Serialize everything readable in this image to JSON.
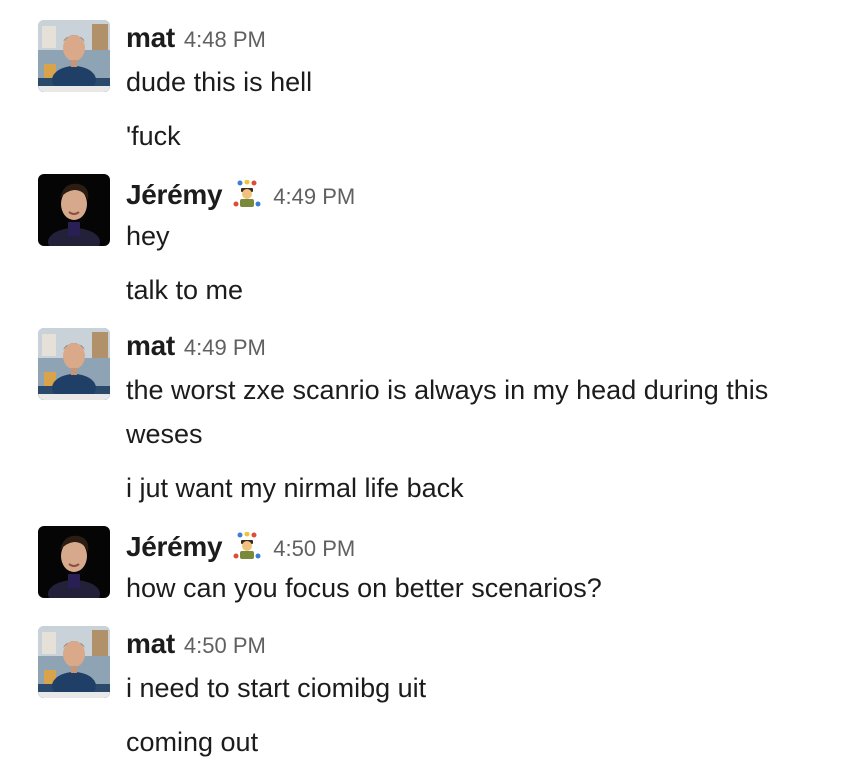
{
  "messages": [
    {
      "author": "mat",
      "time": "4:48 PM",
      "lines": [
        "dude this is hell",
        "'fuck"
      ]
    },
    {
      "author": "Jérémy",
      "status_icon": "juggler-emoji",
      "time": "4:49 PM",
      "lines": [
        "hey",
        "talk to me"
      ]
    },
    {
      "author": "mat",
      "time": "4:49 PM",
      "lines": [
        "the worst  zxe scanrio is always in my head during this",
        "weses",
        "i jut want my nirmal life back"
      ]
    },
    {
      "author": "Jérémy",
      "status_icon": "juggler-emoji",
      "time": "4:50 PM",
      "lines": [
        "how can you focus on better scenarios?"
      ]
    },
    {
      "author": "mat",
      "time": "4:50 PM",
      "lines": [
        "i need to start ciomibg uit",
        "coming out"
      ]
    }
  ]
}
